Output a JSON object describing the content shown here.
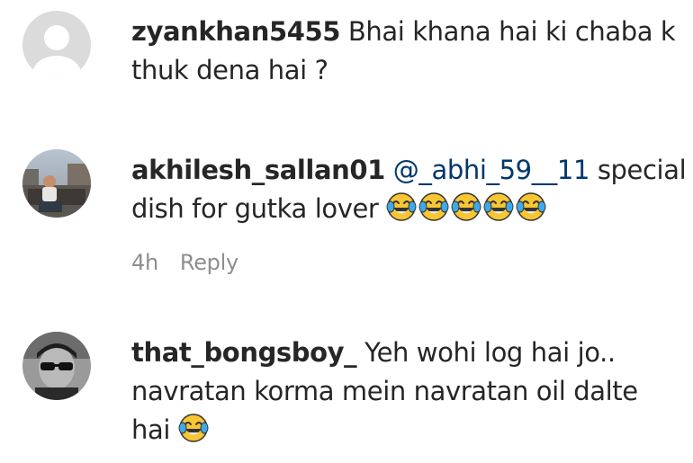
{
  "comments": [
    {
      "username": "zyankhan5455",
      "line1": "Bhai khana hai ki chaba k",
      "line2": "thuk dena hai ?",
      "avatar_icon": "default-avatar-icon"
    },
    {
      "username": "akhilesh_sallan01",
      "mention": "@_abhi_59__11",
      "line1_after": "special",
      "line2": "dish for gutka lover",
      "emoji": "face-with-tears-of-joy-icon",
      "emoji_count": 5,
      "time": "4h",
      "reply_label": "Reply",
      "avatar_icon": "profile-photo"
    },
    {
      "username": "that_bongsboy_",
      "line1": "Yeh wohi log hai jo..",
      "line2": "navratan korma mein navratan oil dalte",
      "line3": "hai",
      "emoji": "face-with-tears-of-joy-icon",
      "avatar_icon": "profile-photo"
    }
  ],
  "colors": {
    "text": "#262626",
    "mention": "#00376b",
    "meta": "#8e8e8e"
  }
}
